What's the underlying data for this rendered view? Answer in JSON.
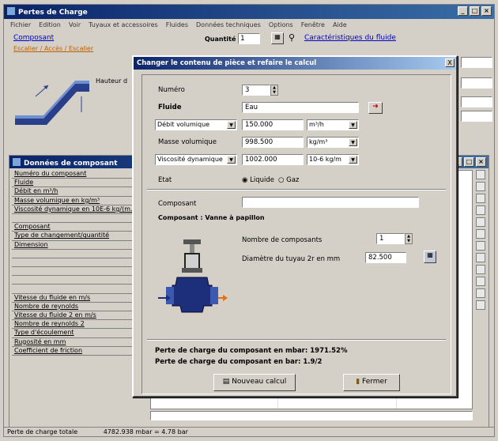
{
  "app": {
    "title": "Pertes de Charge"
  },
  "menu": [
    "Fichier",
    "Edition",
    "Voir",
    "Tuyaux et accessoires",
    "Fluides",
    "Données techniques",
    "Options",
    "Fenêtre",
    "Aide"
  ],
  "toolbar": {
    "component_link": "Composant",
    "category_link": "Escalier / Accès / Escalier",
    "quantity_label": "Quantité",
    "quantity_value": "1",
    "properties_link": "Caractéristiques du fluide",
    "height_label": "Hauteur d"
  },
  "inner_window": {
    "title": "Données de composant",
    "properties": [
      "Numéro du composant",
      "Fluide",
      "Débit en m³/h",
      "Masse volumique en kg/m³",
      "Viscosité dynamique en 10E-6 kg/(m.s)",
      "",
      "Composant",
      "Type de changement/quantité",
      "Dimension",
      "",
      "",
      "",
      "",
      "",
      "Vitesse du fluide en m/s",
      "Nombre de reynolds",
      "Vitesse du fluide 2 en m/s",
      "Nombre de reynolds 2",
      "Type d'écoulement",
      "Rugosité en mm",
      "Coefficient de friction"
    ],
    "status_label": "Perte de charge totale",
    "status_value": "4782.938 mbar = 4.78 bar"
  },
  "dialog": {
    "title": "Changer le contenu de pièce et refaire le calcul",
    "close": "X",
    "numero_label": "Numéro",
    "numero_value": "3",
    "fluide_label": "Fluide",
    "fluide_value": "Eau",
    "debit_select": "Débit volumique",
    "debit_value": "150.000",
    "debit_unit": "m³/h",
    "masse_label": "Masse volumique",
    "masse_value": "998.500",
    "masse_unit": "kg/m³",
    "visco_select": "Viscosité dynamique",
    "visco_value": "1002.000",
    "visco_unit": "10-6 kg/m",
    "etat_label": "Etat",
    "etat_liquide": "Liquide",
    "etat_gaz": "Gaz",
    "composant_label": "Composant",
    "composant_value": "",
    "composant_desc": "Composant : Vanne à papillon",
    "nombre_label": "Nombre de composants",
    "nombre_value": "1",
    "diametre_label": "Diamètre du tuyau 2r en mm",
    "diametre_value": "82.500",
    "result_mbar": "Perte de charge du composant en mbar: 1971.52%",
    "result_bar": "Perte de charge du composant en bar: 1.9/2",
    "btn_new": "Nouveau calcul",
    "btn_close": "Fermer"
  }
}
